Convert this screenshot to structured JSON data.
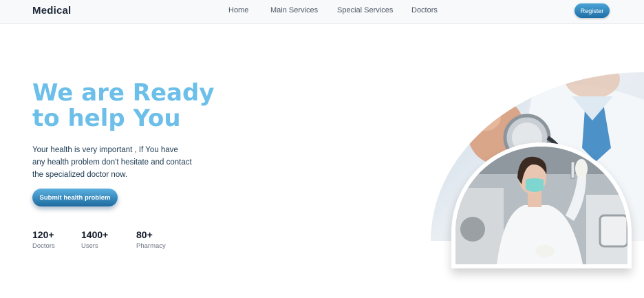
{
  "navbar": {
    "brand": "Medical",
    "links": [
      "Home",
      "Main Services",
      "Special Services",
      "Doctors"
    ],
    "register_label": "Register"
  },
  "hero": {
    "title_lines": [
      "We are Ready",
      "to help You"
    ],
    "description_lines": [
      "Your health is very important , If You have",
      "any health problem don't hesitate and contact",
      "the specialized doctor now."
    ],
    "cta_label": "Submit health problem"
  },
  "stats": [
    {
      "value": "120+",
      "label": "Doctors"
    },
    {
      "value": "1400+",
      "label": "Users"
    },
    {
      "value": "80+",
      "label": "Pharmacy"
    }
  ],
  "colors": {
    "title": "#6cbfe9",
    "button": "#1d6a9f",
    "text": "#1d3a52"
  }
}
